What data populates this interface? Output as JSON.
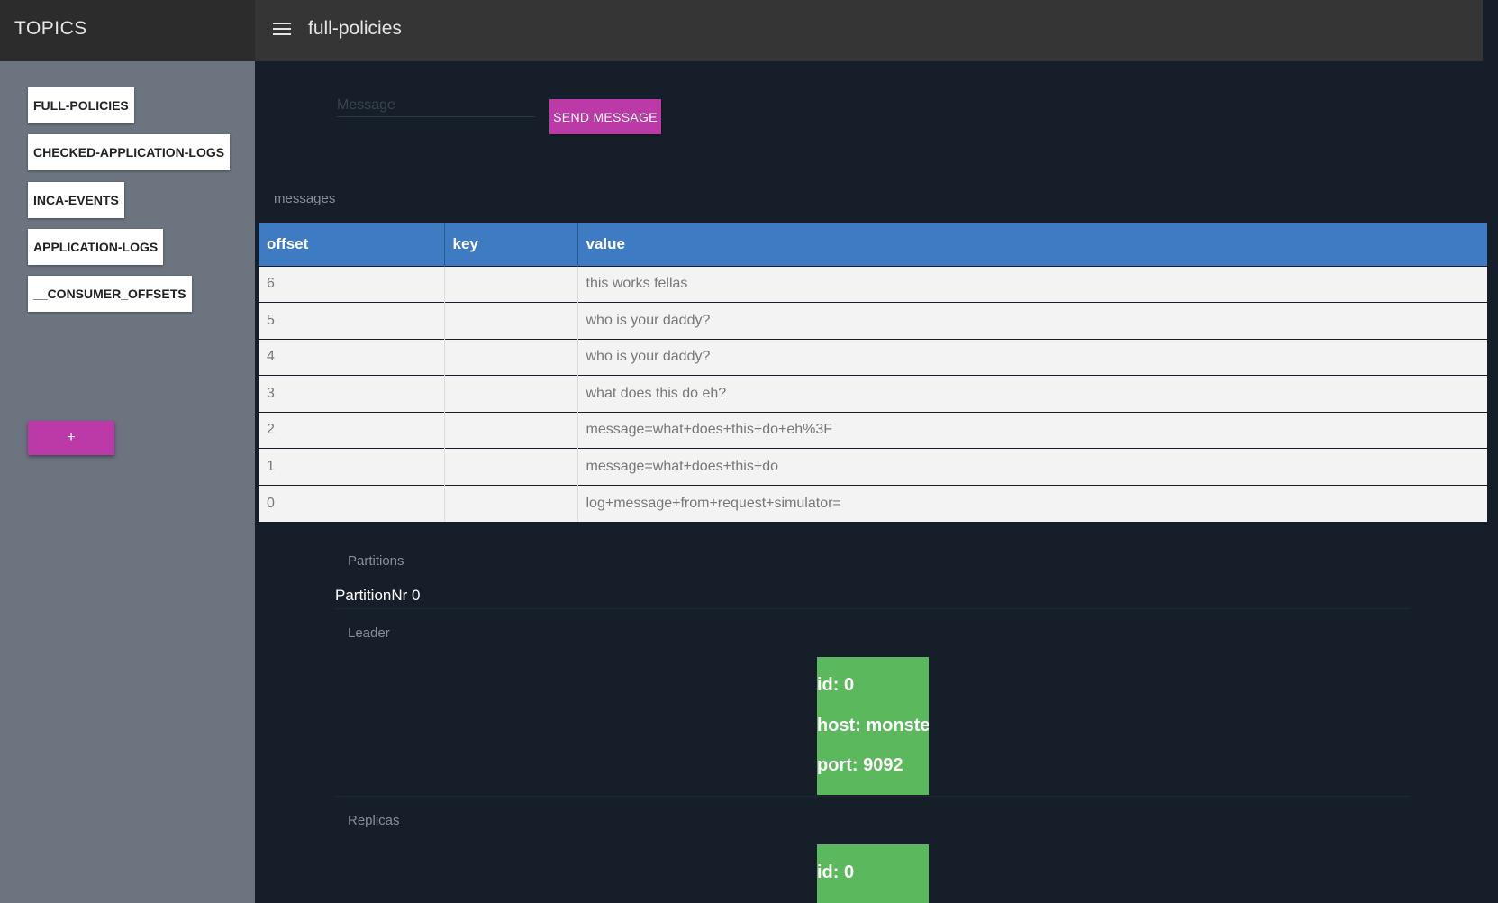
{
  "header": {
    "app_title": "TOPICS",
    "page_title": "full-policies"
  },
  "sidebar": {
    "topics": [
      {
        "label": "FULL-POLICIES"
      },
      {
        "label": "CHECKED-APPLICATION-LOGS"
      },
      {
        "label": "INCA-EVENTS"
      },
      {
        "label": "APPLICATION-LOGS"
      },
      {
        "label": "__CONSUMER_OFFSETS"
      }
    ],
    "add_label": "+"
  },
  "composer": {
    "message_placeholder": "Message",
    "send_label": "SEND MESSAGE"
  },
  "messages": {
    "section_label": "messages",
    "columns": [
      "offset",
      "key",
      "value"
    ],
    "rows": [
      {
        "offset": "6",
        "key": "",
        "value": "this works fellas"
      },
      {
        "offset": "5",
        "key": "",
        "value": "who is your daddy?"
      },
      {
        "offset": "4",
        "key": "",
        "value": "who is your daddy?"
      },
      {
        "offset": "3",
        "key": "",
        "value": "what does this do eh?"
      },
      {
        "offset": "2",
        "key": "",
        "value": "message=what+does+this+do+eh%3F"
      },
      {
        "offset": "1",
        "key": "",
        "value": "message=what+does+this+do"
      },
      {
        "offset": "0",
        "key": "",
        "value": "log+message+from+request+simulator="
      }
    ]
  },
  "partitions": {
    "section_label": "Partitions",
    "partition_title": "PartitionNr 0",
    "leader_label": "Leader",
    "leader": {
      "id": "id: 0",
      "host": "host: monster",
      "port": "port: 9092"
    },
    "replicas_label": "Replicas",
    "replica": {
      "id": "id: 0"
    }
  },
  "colors": {
    "accent": "#bc3aa7",
    "table_header": "#3f7bc3",
    "broker_card": "#5cb85c",
    "sidebar": "#6c7480",
    "background": "#161e29"
  }
}
